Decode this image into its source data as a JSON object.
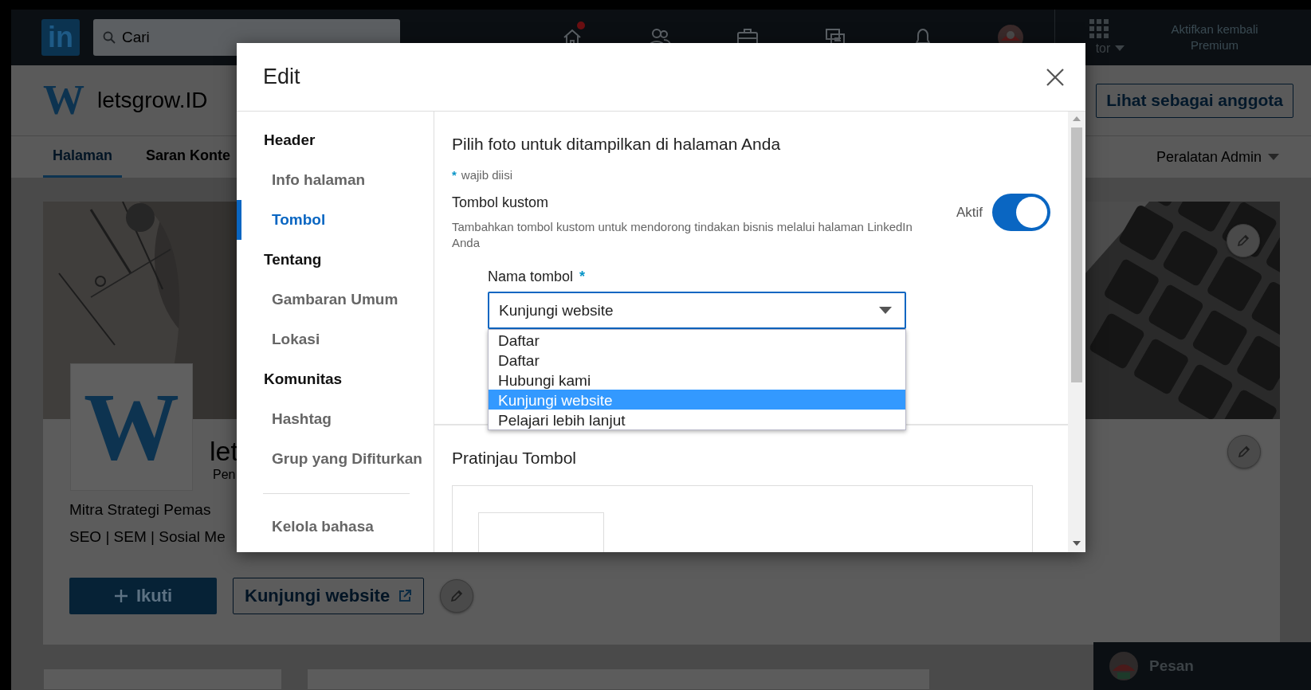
{
  "nav": {
    "brand": "in",
    "search_placeholder": "Cari",
    "items": [
      {
        "kind": "home",
        "notification": true
      },
      {
        "kind": "network",
        "notification": false
      },
      {
        "kind": "jobs",
        "notification": false
      },
      {
        "kind": "messaging",
        "notification": false
      },
      {
        "kind": "notifications",
        "notification": false
      },
      {
        "kind": "avatar",
        "notification": false
      }
    ],
    "apps_label": "tor",
    "premium": "Aktifkan kembali Premium"
  },
  "page": {
    "header_logo": "W",
    "card_logo": "W",
    "name": "letsgrow.ID",
    "view_as_button": "Lihat sebagai anggota",
    "tabs": [
      {
        "label": "Halaman",
        "selected": true
      },
      {
        "label": "Saran Konte",
        "selected": false
      }
    ],
    "admin_tools": "Peralatan Admin",
    "company_name": "let",
    "company_subtitle": "Pen",
    "tagline": [
      "Mitra Strategi Pemas",
      "SEO | SEM | Sosial Me"
    ],
    "follow_button": "Ikuti",
    "website_button": "Kunjungi website"
  },
  "messaging": {
    "label": "Pesan"
  },
  "modal": {
    "title": "Edit",
    "sections": [
      {
        "label": "Header",
        "children": [
          {
            "label": "Info halaman",
            "selected": false
          },
          {
            "label": "Tombol",
            "selected": true
          }
        ]
      },
      {
        "label": "Tentang",
        "children": [
          {
            "label": "Gambaran Umum",
            "selected": false
          },
          {
            "label": "Lokasi",
            "selected": false
          }
        ]
      },
      {
        "label": "Komunitas",
        "children": [
          {
            "label": "Hashtag",
            "selected": false
          },
          {
            "label": "Grup yang Difiturkan",
            "selected": false
          }
        ]
      }
    ],
    "footer_items": [
      {
        "label": "Kelola bahasa",
        "selected": false
      }
    ],
    "heading": "Pilih foto untuk ditampilkan di halaman Anda",
    "required_note": {
      "mark": "*",
      "text": "wajib diisi"
    },
    "custom_button": {
      "title": "Tombol kustom",
      "description": "Tambahkan tombol kustom untuk mendorong tindakan bisnis melalui halaman LinkedIn Anda",
      "toggle_label": "Aktif",
      "on": true
    },
    "button_name": {
      "label": "Nama tombol",
      "required_mark": "*",
      "value": "Kunjungi website",
      "options": [
        {
          "label": "Daftar",
          "selected": false
        },
        {
          "label": "Daftar",
          "selected": false
        },
        {
          "label": "Hubungi kami",
          "selected": false
        },
        {
          "label": "Kunjungi website",
          "selected": true
        },
        {
          "label": "Pelajari lebih lanjut",
          "selected": false
        }
      ]
    },
    "preview_title": "Pratinjau Tombol"
  }
}
